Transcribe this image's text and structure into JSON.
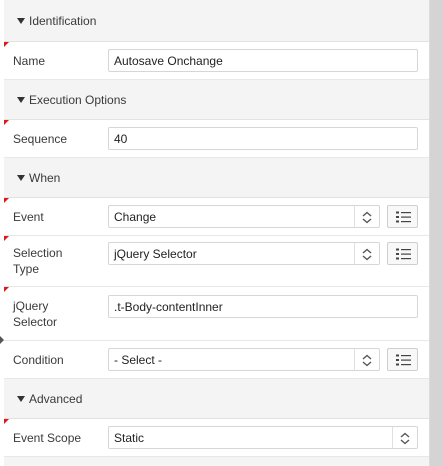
{
  "sections": {
    "identification": {
      "title": "Identification"
    },
    "execution": {
      "title": "Execution Options"
    },
    "when": {
      "title": "When"
    },
    "advanced": {
      "title": "Advanced"
    }
  },
  "fields": {
    "name": {
      "label": "Name",
      "value": "Autosave Onchange"
    },
    "sequence": {
      "label": "Sequence",
      "value": "40"
    },
    "event": {
      "label": "Event",
      "value": "Change"
    },
    "selection_type": {
      "label": "Selection Type",
      "value": "jQuery Selector"
    },
    "jquery_selector": {
      "label": "jQuery Selector",
      "value": ".t-Body-contentInner"
    },
    "condition": {
      "label": "Condition",
      "value": "- Select -"
    },
    "event_scope": {
      "label": "Event Scope",
      "value": "Static"
    }
  },
  "colors": {
    "required_flag": "#e0161b",
    "header_bg": "#f4f4f4"
  },
  "icons": {
    "collapse": "triangle-down-icon",
    "spinner": "chevron-updown-icon",
    "list": "list-icon"
  }
}
